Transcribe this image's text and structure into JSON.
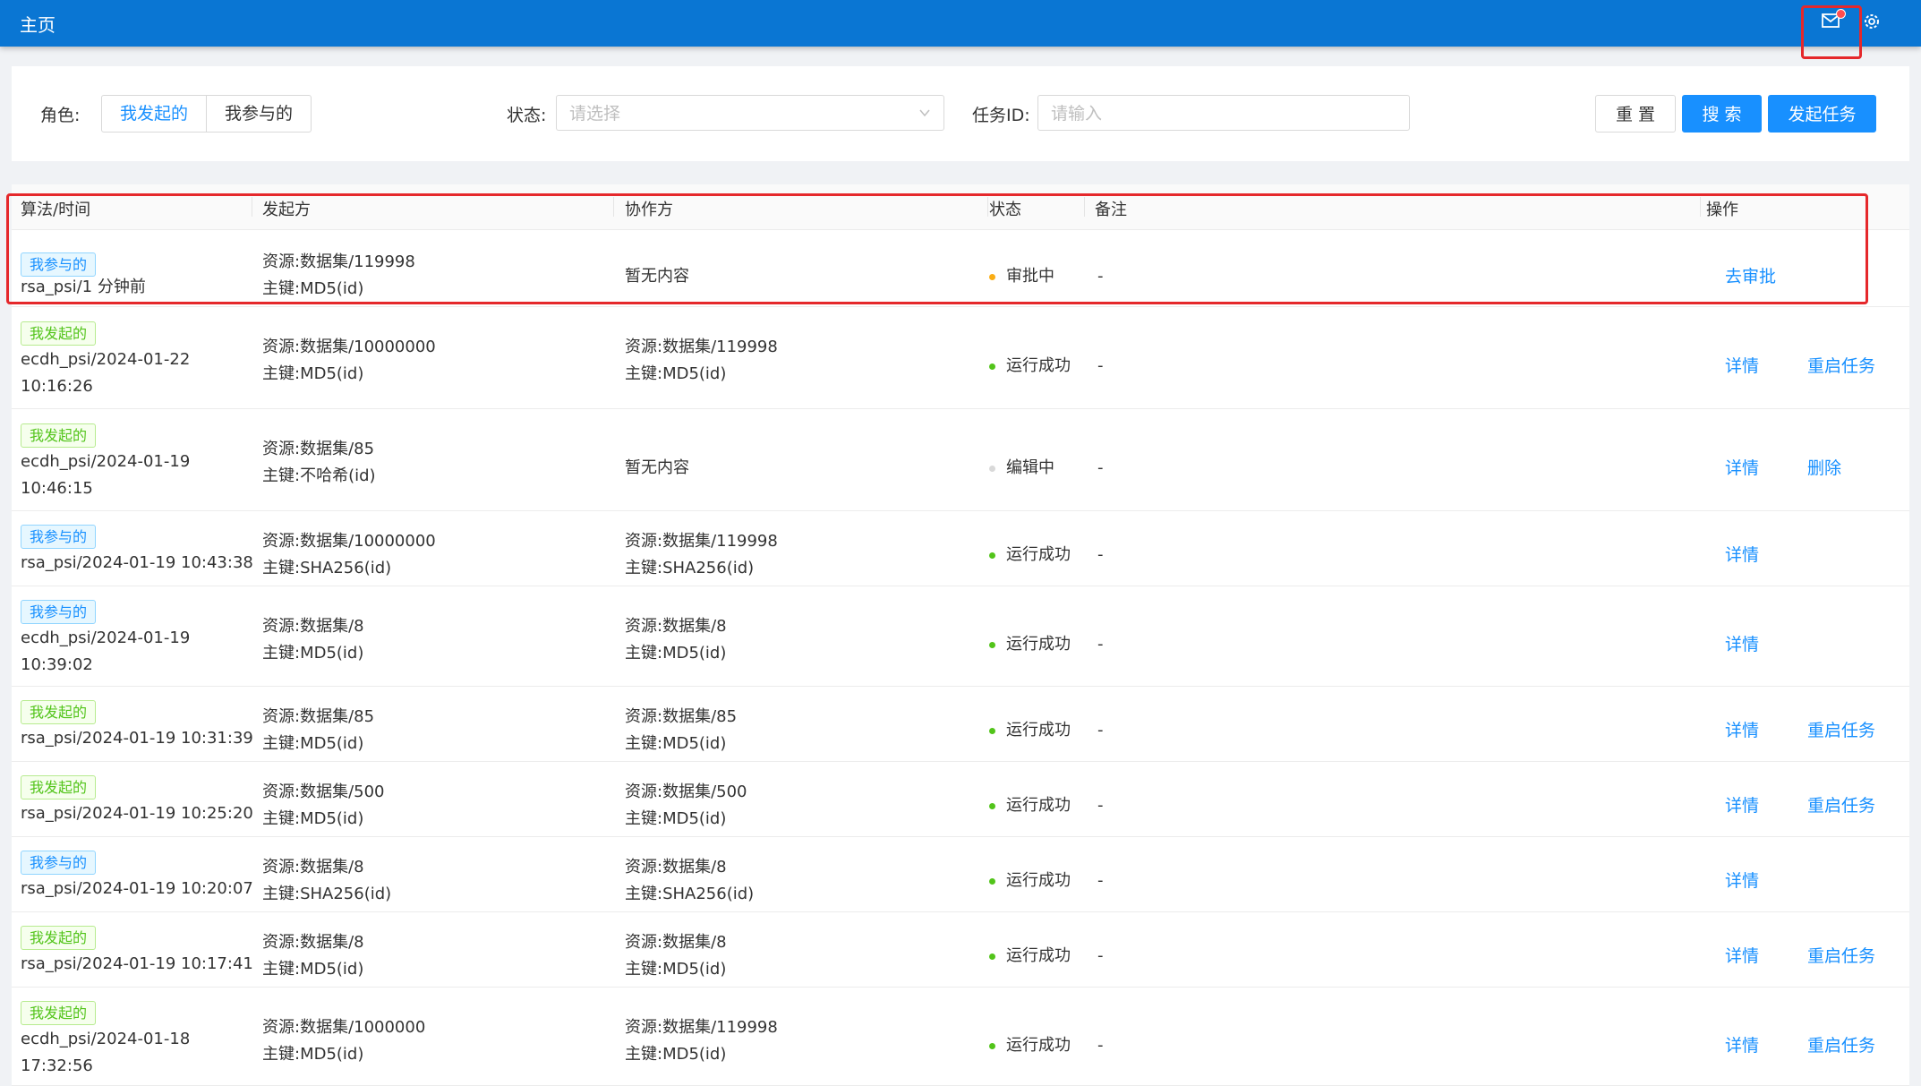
{
  "header": {
    "title": "主页",
    "mail_icon": "mail-icon",
    "gear_icon": "gear-icon",
    "bg_color": "#0a76d3"
  },
  "filters": {
    "role_label": "角色:",
    "role_options": [
      "我发起的",
      "我参与的"
    ],
    "status_label": "状态:",
    "status_placeholder": "请选择",
    "taskid_label": "任务ID:",
    "taskid_placeholder": "请输入",
    "reset_label": "重 置",
    "search_label": "搜 索",
    "create_label": "发起任务"
  },
  "table": {
    "columns": [
      "算法/时间",
      "发起方",
      "协作方",
      "状态",
      "备注",
      "操作"
    ],
    "rows": [
      {
        "tag": "我参与的",
        "tag_type": "part",
        "algo_lines": [
          "rsa_psi/1 分钟前"
        ],
        "initiator": [
          "资源:数据集/119998",
          "主键:MD5(id)"
        ],
        "partner": [
          "暂无内容"
        ],
        "status": "审批中",
        "status_color": "orange",
        "remark": "-",
        "actions": [
          "去审批"
        ]
      },
      {
        "tag": "我发起的",
        "tag_type": "mine",
        "algo_lines": [
          "ecdh_psi/2024-01-22",
          "10:16:26"
        ],
        "initiator": [
          "资源:数据集/10000000",
          "主键:MD5(id)"
        ],
        "partner": [
          "资源:数据集/119998",
          "主键:MD5(id)"
        ],
        "status": "运行成功",
        "status_color": "green",
        "remark": "-",
        "actions": [
          "详情",
          "重启任务"
        ]
      },
      {
        "tag": "我发起的",
        "tag_type": "mine",
        "algo_lines": [
          "ecdh_psi/2024-01-19",
          "10:46:15"
        ],
        "initiator": [
          "资源:数据集/85",
          "主键:不哈希(id)"
        ],
        "partner": [
          "暂无内容"
        ],
        "status": "编辑中",
        "status_color": "grey",
        "remark": "-",
        "actions": [
          "详情",
          "删除"
        ]
      },
      {
        "tag": "我参与的",
        "tag_type": "part",
        "algo_lines": [
          "rsa_psi/2024-01-19 10:43:38"
        ],
        "initiator": [
          "资源:数据集/10000000",
          "主键:SHA256(id)"
        ],
        "partner": [
          "资源:数据集/119998",
          "主键:SHA256(id)"
        ],
        "status": "运行成功",
        "status_color": "green",
        "remark": "-",
        "actions": [
          "详情"
        ]
      },
      {
        "tag": "我参与的",
        "tag_type": "part",
        "algo_lines": [
          "ecdh_psi/2024-01-19",
          "10:39:02"
        ],
        "initiator": [
          "资源:数据集/8",
          "主键:MD5(id)"
        ],
        "partner": [
          "资源:数据集/8",
          "主键:MD5(id)"
        ],
        "status": "运行成功",
        "status_color": "green",
        "remark": "-",
        "actions": [
          "详情"
        ]
      },
      {
        "tag": "我发起的",
        "tag_type": "mine",
        "algo_lines": [
          "rsa_psi/2024-01-19 10:31:39"
        ],
        "initiator": [
          "资源:数据集/85",
          "主键:MD5(id)"
        ],
        "partner": [
          "资源:数据集/85",
          "主键:MD5(id)"
        ],
        "status": "运行成功",
        "status_color": "green",
        "remark": "-",
        "actions": [
          "详情",
          "重启任务"
        ]
      },
      {
        "tag": "我发起的",
        "tag_type": "mine",
        "algo_lines": [
          "rsa_psi/2024-01-19 10:25:20"
        ],
        "initiator": [
          "资源:数据集/500",
          "主键:MD5(id)"
        ],
        "partner": [
          "资源:数据集/500",
          "主键:MD5(id)"
        ],
        "status": "运行成功",
        "status_color": "green",
        "remark": "-",
        "actions": [
          "详情",
          "重启任务"
        ]
      },
      {
        "tag": "我参与的",
        "tag_type": "part",
        "algo_lines": [
          "rsa_psi/2024-01-19 10:20:07"
        ],
        "initiator": [
          "资源:数据集/8",
          "主键:SHA256(id)"
        ],
        "partner": [
          "资源:数据集/8",
          "主键:SHA256(id)"
        ],
        "status": "运行成功",
        "status_color": "green",
        "remark": "-",
        "actions": [
          "详情"
        ]
      },
      {
        "tag": "我发起的",
        "tag_type": "mine",
        "algo_lines": [
          "rsa_psi/2024-01-19 10:17:41"
        ],
        "initiator": [
          "资源:数据集/8",
          "主键:MD5(id)"
        ],
        "partner": [
          "资源:数据集/8",
          "主键:MD5(id)"
        ],
        "status": "运行成功",
        "status_color": "green",
        "remark": "-",
        "actions": [
          "详情",
          "重启任务"
        ]
      },
      {
        "tag": "我发起的",
        "tag_type": "mine",
        "algo_lines": [
          "ecdh_psi/2024-01-18",
          "17:32:56"
        ],
        "initiator": [
          "资源:数据集/1000000",
          "主键:MD5(id)"
        ],
        "partner": [
          "资源:数据集/119998",
          "主键:MD5(id)"
        ],
        "status": "运行成功",
        "status_color": "green",
        "remark": "-",
        "actions": [
          "详情",
          "重启任务"
        ]
      }
    ]
  }
}
